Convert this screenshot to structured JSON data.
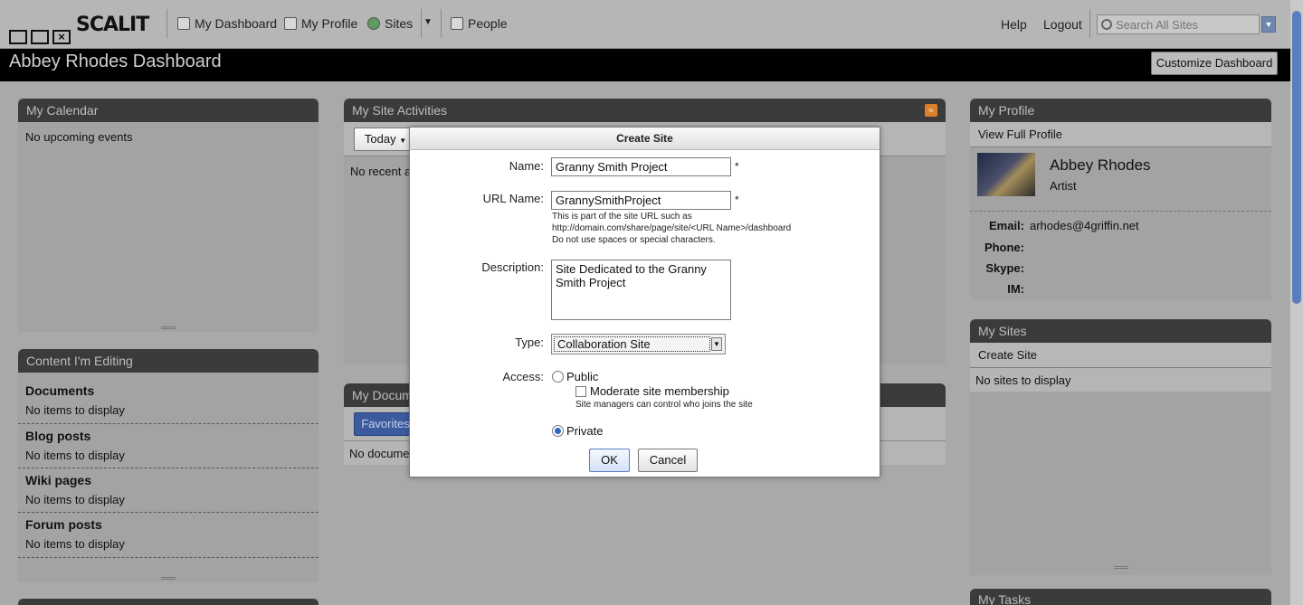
{
  "nav": {
    "logo_text": "SCALIT",
    "items": [
      {
        "label": "My Dashboard",
        "icon": "dashboard-icon"
      },
      {
        "label": "My Profile",
        "icon": "profile-icon"
      },
      {
        "label": "Sites",
        "icon": "globe-icon"
      },
      {
        "label": "People",
        "icon": "people-icon"
      }
    ],
    "help": "Help",
    "logout": "Logout",
    "search_placeholder": "Search All Sites"
  },
  "page": {
    "title": "Abbey Rhodes Dashboard",
    "customize_label": "Customize Dashboard"
  },
  "calendar": {
    "title": "My Calendar",
    "empty": "No upcoming events"
  },
  "editing": {
    "title": "Content I'm Editing",
    "sections": [
      {
        "title": "Documents",
        "empty": "No items to display"
      },
      {
        "title": "Blog posts",
        "empty": "No items to display"
      },
      {
        "title": "Wiki pages",
        "empty": "No items to display"
      },
      {
        "title": "Forum posts",
        "empty": "No items to display"
      }
    ]
  },
  "activities": {
    "title": "My Site Activities",
    "filter": "Today",
    "empty_partial": "No recent a"
  },
  "documents": {
    "title_partial": "My Docume",
    "tab": "Favorites",
    "empty_partial": "No docume"
  },
  "profile": {
    "title": "My Profile",
    "view_full": "View Full Profile",
    "name": "Abbey Rhodes",
    "role": "Artist",
    "fields": [
      {
        "label": "Email:",
        "value": "arhodes@4griffin.net"
      },
      {
        "label": "Phone:",
        "value": ""
      },
      {
        "label": "Skype:",
        "value": ""
      },
      {
        "label": "IM:",
        "value": ""
      }
    ]
  },
  "sites": {
    "title": "My Sites",
    "create": "Create Site",
    "empty": "No sites to display"
  },
  "tasks": {
    "title": "My Tasks"
  },
  "modal": {
    "title": "Create Site",
    "name_label": "Name:",
    "name_value": "Granny Smith Project",
    "url_label": "URL Name:",
    "url_value": "GrannySmithProject",
    "url_hint_1": "This is part of the site URL such as",
    "url_hint_2": "http://domain.com/share/page/site/<URL Name>/dashboard",
    "url_hint_3": "Do not use spaces or special characters.",
    "desc_label": "Description:",
    "desc_value": "Site Dedicated to the Granny Smith Project",
    "type_label": "Type:",
    "type_value": "Collaboration Site",
    "access_label": "Access:",
    "public_label": "Public",
    "moderate_label": "Moderate site membership",
    "moderate_hint": "Site managers can control who joins the site",
    "private_label": "Private",
    "ok_label": "OK",
    "cancel_label": "Cancel",
    "required_mark": "*"
  }
}
